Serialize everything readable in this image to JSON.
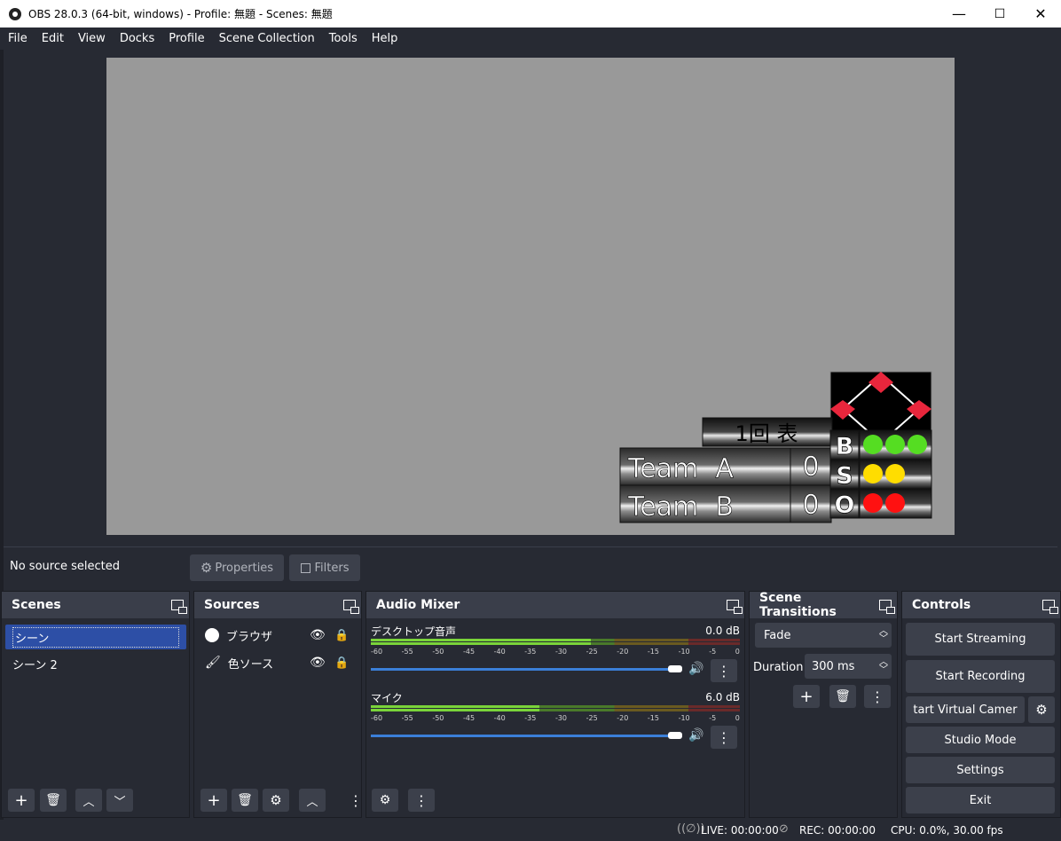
{
  "window": {
    "title": "OBS 28.0.3 (64-bit, windows) - Profile: 無題 - Scenes: 無題",
    "minimize": "—",
    "maximize": "☐",
    "close": "✕"
  },
  "menu": [
    "File",
    "Edit",
    "View",
    "Docks",
    "Profile",
    "Scene Collection",
    "Tools",
    "Help"
  ],
  "preview": {
    "scoreboard": {
      "inning": "1回 表",
      "teams": [
        {
          "name": "Team  A",
          "score": "0"
        },
        {
          "name": "Team  B",
          "score": "0"
        }
      ],
      "counts": [
        {
          "label": "B",
          "color": "#55dd22",
          "count": 3
        },
        {
          "label": "S",
          "color": "#ffdd00",
          "count": 2
        },
        {
          "label": "O",
          "color": "#ff1111",
          "count": 2
        }
      ]
    }
  },
  "source_bar": {
    "no_source": "No source selected",
    "properties": "Properties",
    "filters": "Filters"
  },
  "scenes": {
    "title": "Scenes",
    "items": [
      "シーン",
      "シーン 2"
    ]
  },
  "sources": {
    "title": "Sources",
    "items": [
      "ブラウザ",
      "色ソース"
    ]
  },
  "mixer": {
    "title": "Audio Mixer",
    "channels": [
      {
        "name": "デスクトップ音声",
        "db": "0.0 dB",
        "level": 0.596
      },
      {
        "name": "マイク",
        "db": "6.0 dB",
        "level": 0.457
      }
    ],
    "ticks": [
      "-60",
      "-55",
      "-50",
      "-45",
      "-40",
      "-35",
      "-30",
      "-25",
      "-20",
      "-15",
      "-10",
      "-5",
      "0"
    ]
  },
  "transitions": {
    "title": "Scene Transitions",
    "selected": "Fade",
    "duration_label": "Duration",
    "duration": "300 ms"
  },
  "controls": {
    "title": "Controls",
    "buttons": [
      "Start Streaming",
      "Start Recording",
      "tart Virtual Camer",
      "Studio Mode",
      "Settings",
      "Exit"
    ]
  },
  "status": {
    "live": "LIVE: 00:00:00",
    "rec": "REC: 00:00:00",
    "cpu": "CPU: 0.0%, 30.00 fps"
  },
  "colors": {
    "bg": "#272a33",
    "header": "#3a3e4a",
    "button": "#3c404b",
    "accent": "#3b7fd8",
    "selected": "#2d4fa6"
  }
}
